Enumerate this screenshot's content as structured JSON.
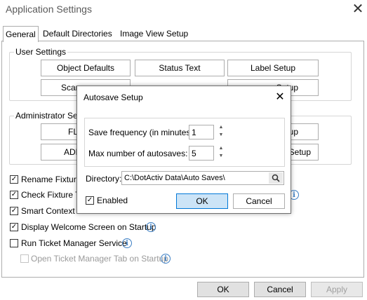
{
  "window": {
    "title": "Application Settings"
  },
  "tabs": [
    {
      "label": "General"
    },
    {
      "label": "Default Directories"
    },
    {
      "label": "Image View Setup"
    }
  ],
  "user_settings": {
    "label": "User Settings",
    "buttons": [
      "Object Defaults",
      "Status Text",
      "Label Setup",
      "Scan",
      "Setup"
    ]
  },
  "admin_settings": {
    "label": "Administrator Settin",
    "buttons": [
      "FL",
      "ADD",
      "tup",
      "Setup"
    ]
  },
  "checkboxes": [
    {
      "label": "Rename Fixtures",
      "checked": true
    },
    {
      "label": "Check Fixture Typ",
      "checked": true
    },
    {
      "label": "Smart Context Ca",
      "checked": true
    },
    {
      "label": "Display Welcome Screen on Startup",
      "checked": true
    },
    {
      "label": "Run Ticket Manager Service",
      "checked": false
    },
    {
      "label": "Open Ticket Manager Tab on Startup",
      "checked": false,
      "disabled": true
    }
  ],
  "footer": {
    "ok": "OK",
    "cancel": "Cancel",
    "apply": "Apply"
  },
  "dialog": {
    "title": "Autosave Setup",
    "save_frequency_label": "Save frequency (in minutes):",
    "save_frequency_value": "1",
    "max_autosaves_label": "Max number of autosaves:",
    "max_autosaves_value": "5",
    "directory_label": "Directory:",
    "directory_value": "C:\\DotActiv Data\\Auto Saves\\",
    "enabled_label": "Enabled",
    "enabled_checked": true,
    "ok": "OK",
    "cancel": "Cancel"
  },
  "icons": {
    "close": "close-icon",
    "info": "info-icon",
    "search": "search-icon",
    "spin_up": "spin-up-icon",
    "spin_down": "spin-down-icon",
    "check": "check-icon"
  },
  "colors": {
    "info": "#3d7fc4",
    "primary_border": "#0078d7",
    "primary_bg": "#cce4f7"
  }
}
